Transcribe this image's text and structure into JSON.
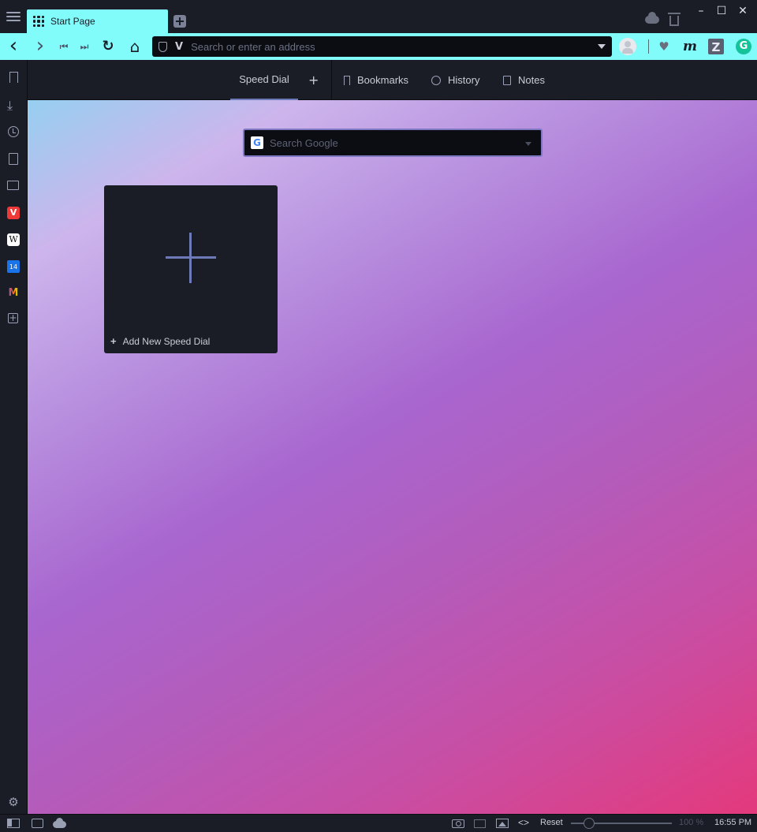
{
  "tabbar": {
    "tabs": [
      {
        "label": "Start Page",
        "icon": "speed-dial-grid-icon",
        "active": true
      }
    ],
    "accent_color": "#82fbfb",
    "window_controls": {
      "minimize": "–",
      "maximize": "☐",
      "close": "✕"
    }
  },
  "toolbar": {
    "back": "‹",
    "forward": "›",
    "rewind": "⏮",
    "fastforward": "⏭",
    "reload": "↻",
    "home": "⌂",
    "address_placeholder": "Search or enter an address",
    "extensions": {
      "m_label": "m",
      "z_label": "Z",
      "g_label": "G",
      "heart": "♥"
    }
  },
  "sidebar": {
    "items": [
      {
        "name": "bookmarks",
        "icon": "bookmark-icon"
      },
      {
        "name": "downloads",
        "icon": "download-icon"
      },
      {
        "name": "history",
        "icon": "history-icon"
      },
      {
        "name": "notes",
        "icon": "notes-icon"
      },
      {
        "name": "window",
        "icon": "window-icon"
      },
      {
        "name": "vivaldi",
        "icon": "vivaldi-icon",
        "label": "V"
      },
      {
        "name": "wikipedia",
        "icon": "wikipedia-icon",
        "label": "W"
      },
      {
        "name": "calendar",
        "icon": "calendar-icon",
        "label": "14"
      },
      {
        "name": "gmail",
        "icon": "gmail-icon",
        "label": "M"
      },
      {
        "name": "add-panel",
        "icon": "add-panel-icon",
        "label": "+"
      }
    ],
    "settings_icon": "⚙"
  },
  "startpage": {
    "tabs": [
      {
        "label": "Speed Dial",
        "active": true
      },
      {
        "label": "Bookmarks",
        "icon": "bookmark-icon"
      },
      {
        "label": "History",
        "icon": "history-icon"
      },
      {
        "label": "Notes",
        "icon": "notes-icon"
      }
    ],
    "add_label": "+",
    "search_placeholder": "Search Google",
    "search_engine_icon": "G",
    "dial": {
      "label": "Add New Speed Dial",
      "plus": "+"
    }
  },
  "statusbar": {
    "code_label": "<>",
    "reset_label": "Reset",
    "zoom": "100 %",
    "zoom_percent": 100,
    "time": "16:55 PM"
  }
}
